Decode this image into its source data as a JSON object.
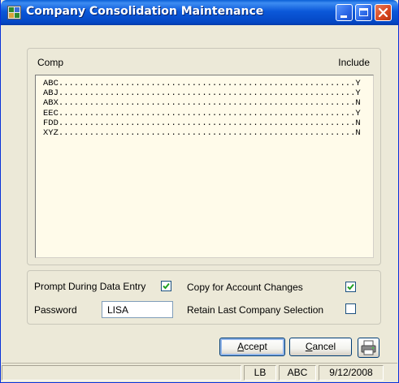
{
  "window": {
    "title": "Company Consolidation Maintenance"
  },
  "list": {
    "header_comp": "Comp",
    "header_include": "Include",
    "rows": [
      {
        "comp": "ABC",
        "include": "Y"
      },
      {
        "comp": "ABJ",
        "include": "Y"
      },
      {
        "comp": "ABX",
        "include": "N"
      },
      {
        "comp": "EEC",
        "include": "Y"
      },
      {
        "comp": "FDD",
        "include": "N"
      },
      {
        "comp": "XYZ",
        "include": "N"
      }
    ]
  },
  "options": {
    "prompt_label": "Prompt During Data Entry",
    "prompt_checked": true,
    "copy_label": "Copy for Account Changes",
    "copy_checked": true,
    "password_label": "Password",
    "password_value": "LISA",
    "retain_label": "Retain Last Company Selection",
    "retain_checked": false
  },
  "buttons": {
    "accept_hotkey": "A",
    "accept_rest": "ccept",
    "cancel_hotkey": "C",
    "cancel_rest": "ancel",
    "print_icon": "printer-icon"
  },
  "status": {
    "user": "LB",
    "company": "ABC",
    "date": "9/12/2008"
  },
  "colors": {
    "title_bar": "#0b58d9",
    "list_background": "#fffbea",
    "dialog_background": "#ece9d8",
    "check_green": "#21a121"
  }
}
